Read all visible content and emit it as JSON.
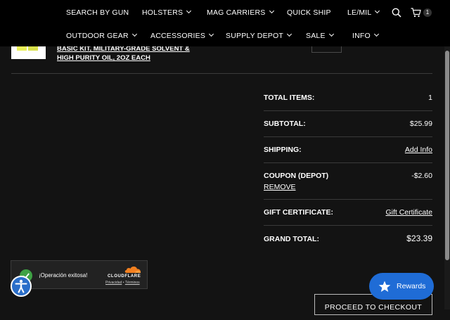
{
  "nav": {
    "row1": [
      {
        "label": "SEARCH BY GUN",
        "dropdown": false
      },
      {
        "label": "HOLSTERS",
        "dropdown": true
      },
      {
        "label": "MAG CARRIERS",
        "dropdown": true
      },
      {
        "label": "QUICK SHIP",
        "dropdown": false
      },
      {
        "label": "LE/MIL",
        "dropdown": true
      }
    ],
    "row2": [
      {
        "label": "OUTDOOR GEAR",
        "dropdown": true
      },
      {
        "label": "ACCESSORIES",
        "dropdown": true
      },
      {
        "label": "SUPPLY DEPOT",
        "dropdown": true
      },
      {
        "label": "SALE",
        "dropdown": true
      },
      {
        "label": "INFO",
        "dropdown": true
      }
    ],
    "search_icon": "search-icon",
    "cart_icon": "cart-icon",
    "cart_count": "1"
  },
  "product": {
    "name_line1": "BASIC KIT, MILITARY-GRADE SOLVENT &",
    "name_line2": "HIGH PURITY OIL, 2OZ EACH"
  },
  "totals": {
    "total_items_label": "TOTAL ITEMS:",
    "total_items_value": "1",
    "subtotal_label": "SUBTOTAL:",
    "subtotal_value": "$25.99",
    "shipping_label": "SHIPPING:",
    "shipping_value": "Add Info",
    "coupon_label": "COUPON (DEPOT)",
    "coupon_value": "-$2.60",
    "coupon_remove": "REMOVE",
    "gift_label": "GIFT CERTIFICATE:",
    "gift_value": "Gift Certificate",
    "grand_total_label": "GRAND TOTAL:",
    "grand_total_value": "$23.39"
  },
  "checkout_label": "PROCEED TO CHECKOUT",
  "rewards_label": "Rewards",
  "cloudflare": {
    "message": "¡Operación exitosa!",
    "brand": "CLOUDFLARE",
    "privacy": "Privacidad",
    "separator": " • ",
    "terms": "Términos"
  },
  "colors": {
    "background": "#131313",
    "nav_background": "#000000",
    "rewards_blue": "#1f6cd6",
    "success_green": "#3ea244",
    "cloudflare_orange": "#f38020"
  }
}
